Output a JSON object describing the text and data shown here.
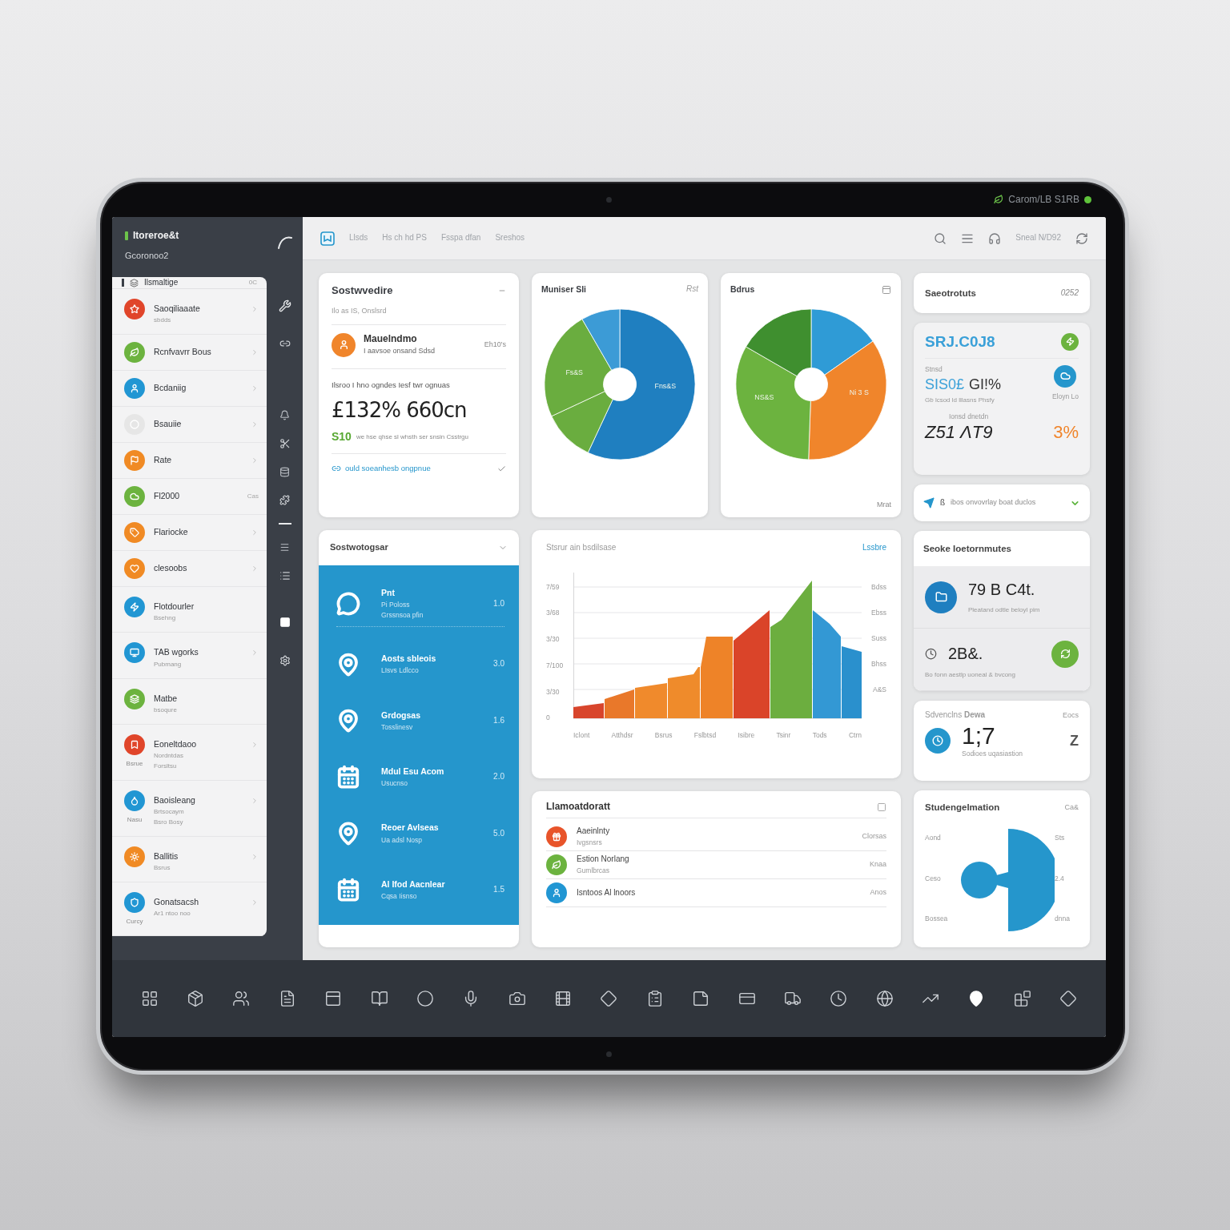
{
  "device": {
    "status_text": "Carom/LB S1RB"
  },
  "sidebar": {
    "brand": "Itoreroe&t",
    "subtitle": "Gcoronoo2",
    "panel": {
      "title": "Ilsmaltige",
      "badge": "0C",
      "items": [
        {
          "label": "Saoqiliaaate",
          "sub": "sbdds",
          "color": "#e0452a",
          "chevron": true
        },
        {
          "label": "Rcnfvavrr Bous",
          "color": "#6cb33f",
          "chevron": true
        },
        {
          "label": "Bcdaniig",
          "color": "#2196d3",
          "chevron": true
        },
        {
          "label": "Bsauiie",
          "color": "#e6e6e6",
          "chevron": true
        },
        {
          "label": "Rate",
          "color": "#f08a24",
          "chevron": true
        },
        {
          "label": "Fl2000",
          "color": "#6cb33f",
          "chevron": false,
          "meta": "Cas"
        },
        {
          "label": "Flariocke",
          "color": "#f08a24",
          "chevron": true
        },
        {
          "label": "clesoobs",
          "color": "#f08a24",
          "chevron": true
        },
        {
          "label": "Flotdourler",
          "sub": "Bsehng",
          "color": "#2196d3",
          "chevron": false
        },
        {
          "label": "TAB wgorks",
          "sub": "Pubmang",
          "color": "#2196d3",
          "chevron": true
        },
        {
          "label": "Matbe",
          "sub": "bsoqure",
          "color": "#6cb33f",
          "chevron": false
        },
        {
          "label": "Eoneltdaoo",
          "sub": "Nordntdas",
          "extra": "Forsltsu",
          "note": "Bsrue",
          "color": "#e0452a",
          "chevron": true
        },
        {
          "label": "Baoisleang",
          "sub": "Brtsocaym",
          "extra": "Bsro Bosy",
          "note": "Nasu",
          "color": "#2196d3",
          "chevron": true
        },
        {
          "label": "Ballitis",
          "sub": "Bsrus",
          "color": "#f08a24",
          "chevron": true
        },
        {
          "label": "Gonatsacsh",
          "sub": "Ar1 ntoo noo",
          "note": "Curcy",
          "color": "#2196d3",
          "chevron": true
        }
      ]
    }
  },
  "topbar": {
    "breadcrumbs": [
      "Llsds",
      "Hs ch hd PS",
      "Fsspa dfan",
      "Sreshos"
    ],
    "user": "Sneal N/D92"
  },
  "summary_card": {
    "title": "Sostwvedire",
    "subtitle": "Ilo as IS, Onslsrd",
    "entry": {
      "title": "Mauelndmo",
      "sub": "I aavsoe onsand  Sdsd",
      "value": "Eh10's"
    },
    "caption": "Ilsroo I hno ogndes Iesf twr ognuas",
    "big_value": "£132% 660cn",
    "delta": "S10",
    "delta_note": "we hse qhse sl whsth ser snsin Csstrgu",
    "link": "ould soeanhesb ongpnue"
  },
  "pie_cards": [
    {
      "title": "Muniser Sli",
      "corner": "Rst",
      "labels": [
        "Fs&S",
        "Fns&S"
      ]
    },
    {
      "title": "Bdrus",
      "footer": "Mrat",
      "labels": [
        "NS&S",
        "Ni 3 S"
      ]
    }
  ],
  "task_list": {
    "title": "Sostwotogsar",
    "rows": [
      {
        "kind": "chat",
        "title": "Pnt",
        "lines": [
          "Pi Poloss",
          "Grssnsoa pfin"
        ],
        "value": "1.0"
      },
      {
        "kind": "pin",
        "title": "Aosts sbleois",
        "lines": [
          "LIsvs Ldlcco"
        ],
        "value": "3.0"
      },
      {
        "kind": "pin",
        "title": "Grdogsas",
        "lines": [
          "Tosslinesv"
        ],
        "value": "1.6"
      },
      {
        "kind": "calendar",
        "title": "Mdul Esu Acom",
        "lines": [
          "Usucnso"
        ],
        "value": "2.0"
      },
      {
        "kind": "pin",
        "title": "Reoer Avlseas",
        "lines": [
          "Ua adsl Nosp"
        ],
        "value": "5.0"
      },
      {
        "kind": "calendar",
        "title": "Al Ifod Aacnlear",
        "lines": [
          "Cqsa Iisnso"
        ],
        "value": "1.5"
      }
    ]
  },
  "trend_card": {
    "title": "Stsrur ain bsdilsase",
    "action": "Lssbre",
    "y_labels": [
      "7/59",
      "3/68",
      "3/30",
      "7/100",
      "3/30",
      "0"
    ],
    "right_labels": [
      "Bdss",
      "Ebss",
      "Suss",
      "Bhss",
      "A&S"
    ],
    "x_labels": [
      "Iclont",
      "Atthdsr",
      "Bsrus",
      "Fslbtsd",
      "Isibre",
      "Tsinr",
      "Tods",
      "Ctrn"
    ]
  },
  "activity_card": {
    "title": "Llamoatdoratt",
    "rows": [
      {
        "color": "#e8542a",
        "title": "Aaeinlnty",
        "sub": "Ivgsnsrs",
        "value": "Clorsas"
      },
      {
        "color": "#6cb33f",
        "title": "Estion Norlang",
        "sub": "Gumlbrcas",
        "value": "Knaa"
      },
      {
        "color": "#2196d3",
        "title": "Isntoos Al lnoors",
        "value": "Anos"
      }
    ]
  },
  "header_card": {
    "title": "Saeotrotuts",
    "value": "0252"
  },
  "stats_card": {
    "headline": "SRJ.C0J8",
    "label_1": "Stnsd",
    "value_1a": "SIS0£",
    "value_1b": "GI!%",
    "note_1": "Gb lcsod ld lllasns Phsfy",
    "side_note": "Eloyn Lo",
    "label_2": "Ionsd dnetdn",
    "value_2": "Z51 ΛT9",
    "percent": "3%"
  },
  "notice_card": {
    "mark": "ß",
    "text": "ibos onvovrlay boat duclos"
  },
  "insight_card": {
    "title": "Seoke Ioetornmutes",
    "rows": [
      {
        "kind": "leading",
        "value": "79 B C4t.",
        "note": "Pleatand odtle beloyl pim"
      },
      {
        "kind": "trailing",
        "value": "2B&.",
        "note": "Bo fonn aestlp uoneal & bvcong"
      }
    ]
  },
  "device_card": {
    "label": "Sdvenclns **Dewa**",
    "corner": "Eocs",
    "value": "1;7",
    "note": "Sodioes uqasiastion",
    "side": "Z"
  },
  "segment_card": {
    "title": "Studengelmation",
    "corner": "Ca&",
    "left_labels": [
      "Aond",
      "Ceso",
      "Bossea"
    ],
    "right_labels": [
      "Sts",
      "2.4",
      "dnna"
    ]
  }
}
